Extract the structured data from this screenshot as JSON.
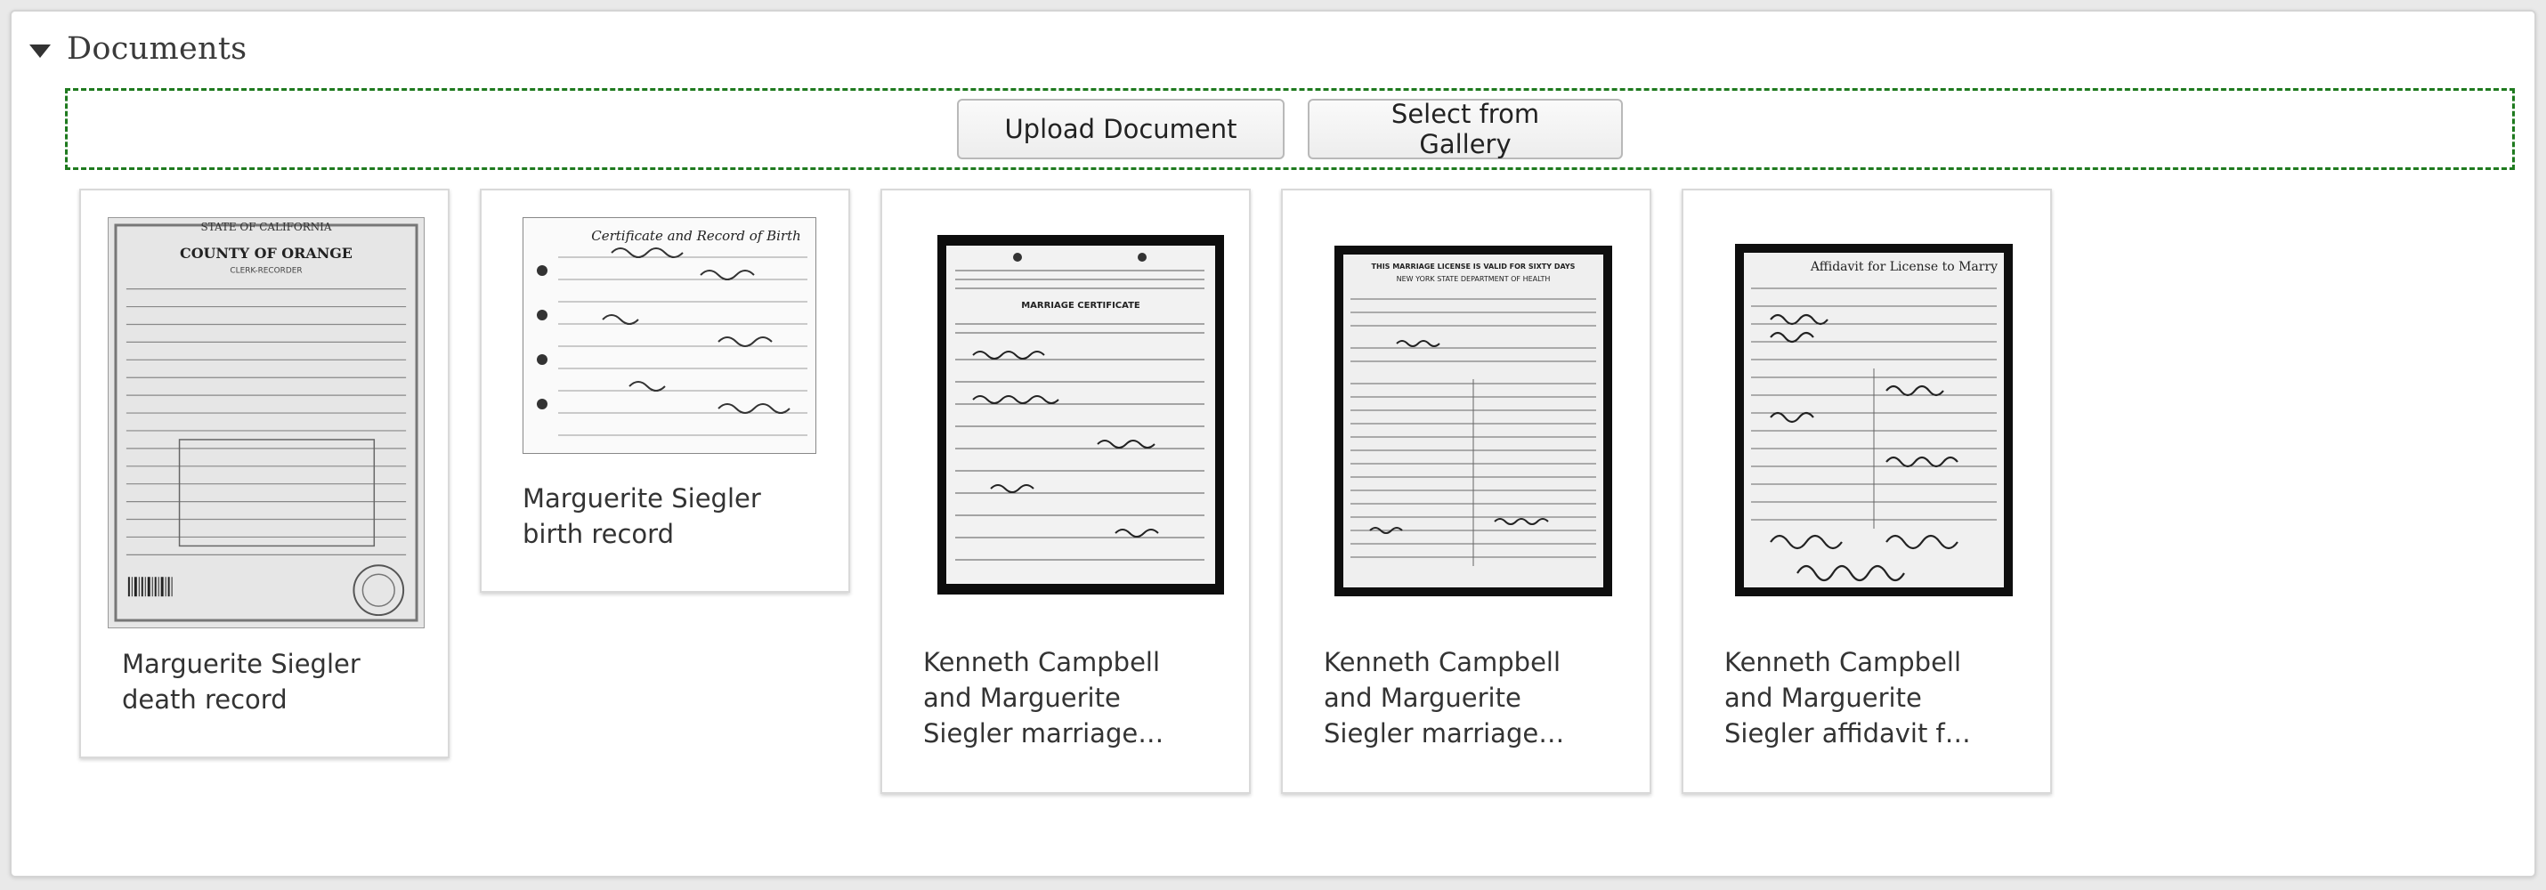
{
  "section": {
    "title": "Documents",
    "toggle_icon": "caret-down-icon"
  },
  "actions": {
    "upload_label": "Upload Document",
    "gallery_label": "Select from Gallery",
    "dropzone_border_color": "#1f7a1f"
  },
  "documents": [
    {
      "caption_line1": "Marguerite Siegler",
      "caption_line2": "death record",
      "caption_line3": "",
      "thumbnail_icon": "certificate-thumbnail"
    },
    {
      "caption_line1": "Marguerite Siegler",
      "caption_line2": "birth record",
      "caption_line3": "",
      "thumbnail_icon": "certificate-thumbnail"
    },
    {
      "caption_line1": "Kenneth Campbell",
      "caption_line2": "and Marguerite",
      "caption_line3": "Siegler marriage…",
      "thumbnail_icon": "certificate-thumbnail"
    },
    {
      "caption_line1": "Kenneth Campbell",
      "caption_line2": "and Marguerite",
      "caption_line3": "Siegler marriage…",
      "thumbnail_icon": "certificate-thumbnail"
    },
    {
      "caption_line1": "Kenneth Campbell",
      "caption_line2": "and Marguerite",
      "caption_line3": "Siegler affidavit f…",
      "thumbnail_icon": "certificate-thumbnail"
    }
  ]
}
